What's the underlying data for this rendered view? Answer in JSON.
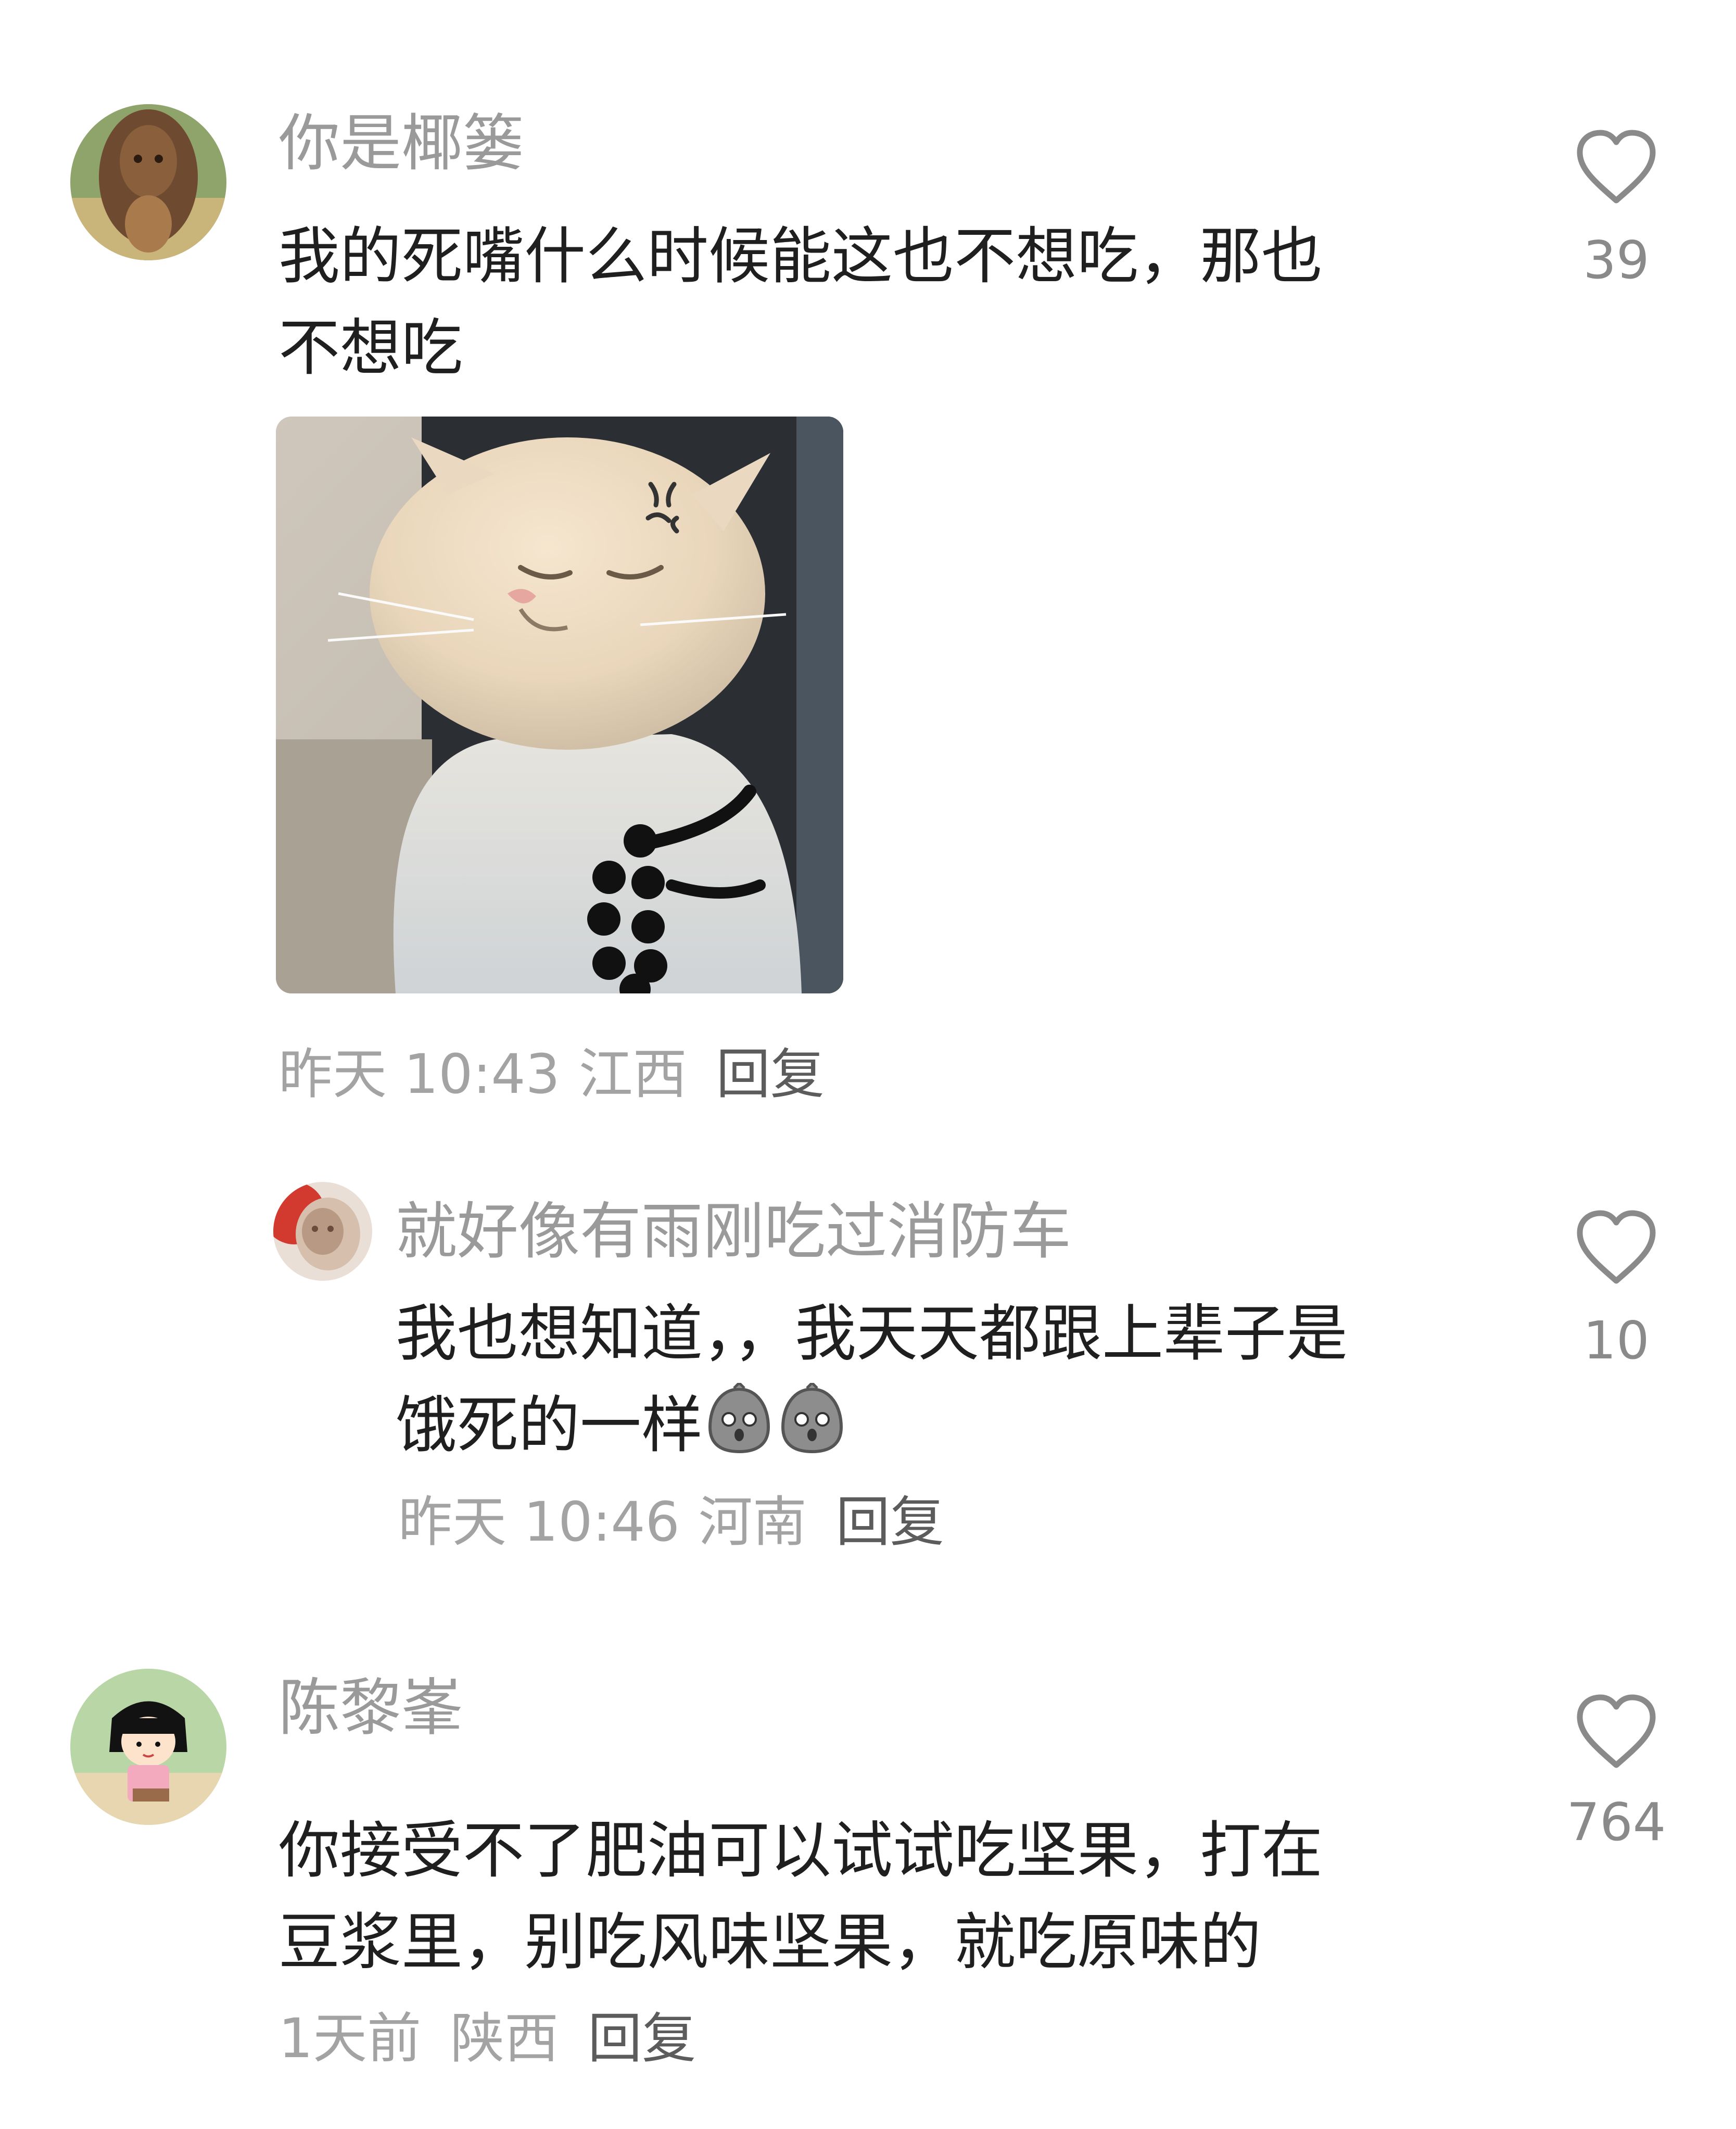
{
  "comments": [
    {
      "username": "你是椰篓",
      "text_lines": [
        "我的死嘴什么时候能这也不想吃，那也",
        "不想吃"
      ],
      "time": "昨天 10:43",
      "location": "江西",
      "reply_label": "回复",
      "likes": "39",
      "avatar_icon": "lion-avatar",
      "image": {
        "icon": "cat-sticker",
        "alt_icon": "anger-mark-icon"
      }
    },
    {
      "username": "就好像有雨刚吃过消防车",
      "text_lines": [
        "我也想知道，，我天天都跟上辈子是",
        "饿死的一样"
      ],
      "emoji": [
        "shocked-face-emoji",
        "shocked-face-emoji"
      ],
      "time": "昨天 10:46",
      "location": "河南",
      "reply_label": "回复",
      "likes": "10",
      "avatar_icon": "cat-avatar"
    },
    {
      "username": "陈黎峯",
      "text_lines": [
        "你接受不了肥油可以试试吃坚果，打在",
        "豆浆里，别吃风味坚果，就吃原味的"
      ],
      "time": "1天前",
      "location": "陕西",
      "reply_label": "回复",
      "likes": "764",
      "avatar_icon": "cartoon-girl-avatar"
    }
  ],
  "colors": {
    "username": "#9a9a9a",
    "body_text": "#1f1f1f",
    "meta_text": "#a3a3a3",
    "reply_text": "#5c5c5c",
    "like_icon": "#8a8a8a"
  }
}
